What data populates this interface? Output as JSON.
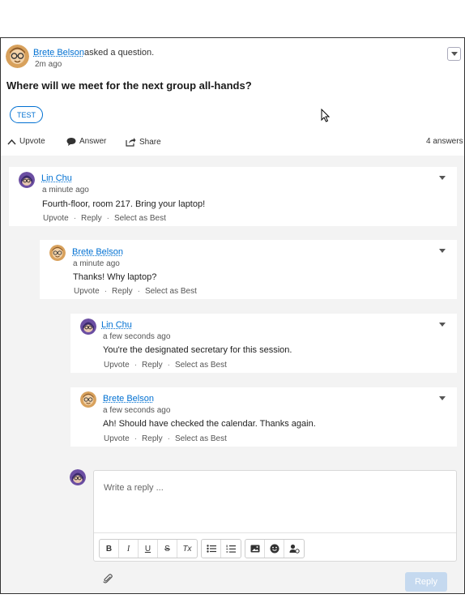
{
  "question": {
    "author": "Brete Belson",
    "action": "asked a question.",
    "time": "2m ago",
    "title": "Where will we meet for the next group all-hands?",
    "topic": "TEST",
    "actions": {
      "upvote": "Upvote",
      "answer": "Answer",
      "share": "Share"
    },
    "answers_count": "4 answers"
  },
  "answers": [
    {
      "author": "Lin Chu",
      "time": "a minute ago",
      "text": "Fourth-floor, room 217. Bring your laptop!",
      "upvote": "Upvote",
      "reply": "Reply",
      "best": "Select as Best",
      "sep": "·",
      "avatar": "purple-avatar"
    },
    {
      "author": "Brete Belson",
      "time": "a minute ago",
      "text": "Thanks! Why laptop?",
      "upvote": "Upvote",
      "reply": "Reply",
      "best": "Select as Best",
      "sep": "·",
      "avatar": "tan-avatar"
    },
    {
      "author": "Lin Chu",
      "time": "a few seconds ago",
      "text": "You're the designated secretary for this session.",
      "upvote": "Upvote",
      "reply": "Reply",
      "best": "Select as Best",
      "sep": "·",
      "avatar": "purple-avatar"
    },
    {
      "author": "Brete Belson",
      "time": "a few seconds ago",
      "text": "Ah! Should have checked the calendar. Thanks again.",
      "upvote": "Upvote",
      "reply": "Reply",
      "best": "Select as Best",
      "sep": "·",
      "avatar": "tan-avatar"
    }
  ],
  "reply_editor": {
    "placeholder": "Write a reply ...",
    "toolbar": {
      "bold": "B",
      "italic": "I",
      "underline": "U",
      "strike": "S",
      "clear": "Tx"
    },
    "submit": "Reply"
  },
  "colors": {
    "link": "#0070d2",
    "thread_bg": "#f3f3f3",
    "reply_disabled": "#c5d9ef"
  }
}
